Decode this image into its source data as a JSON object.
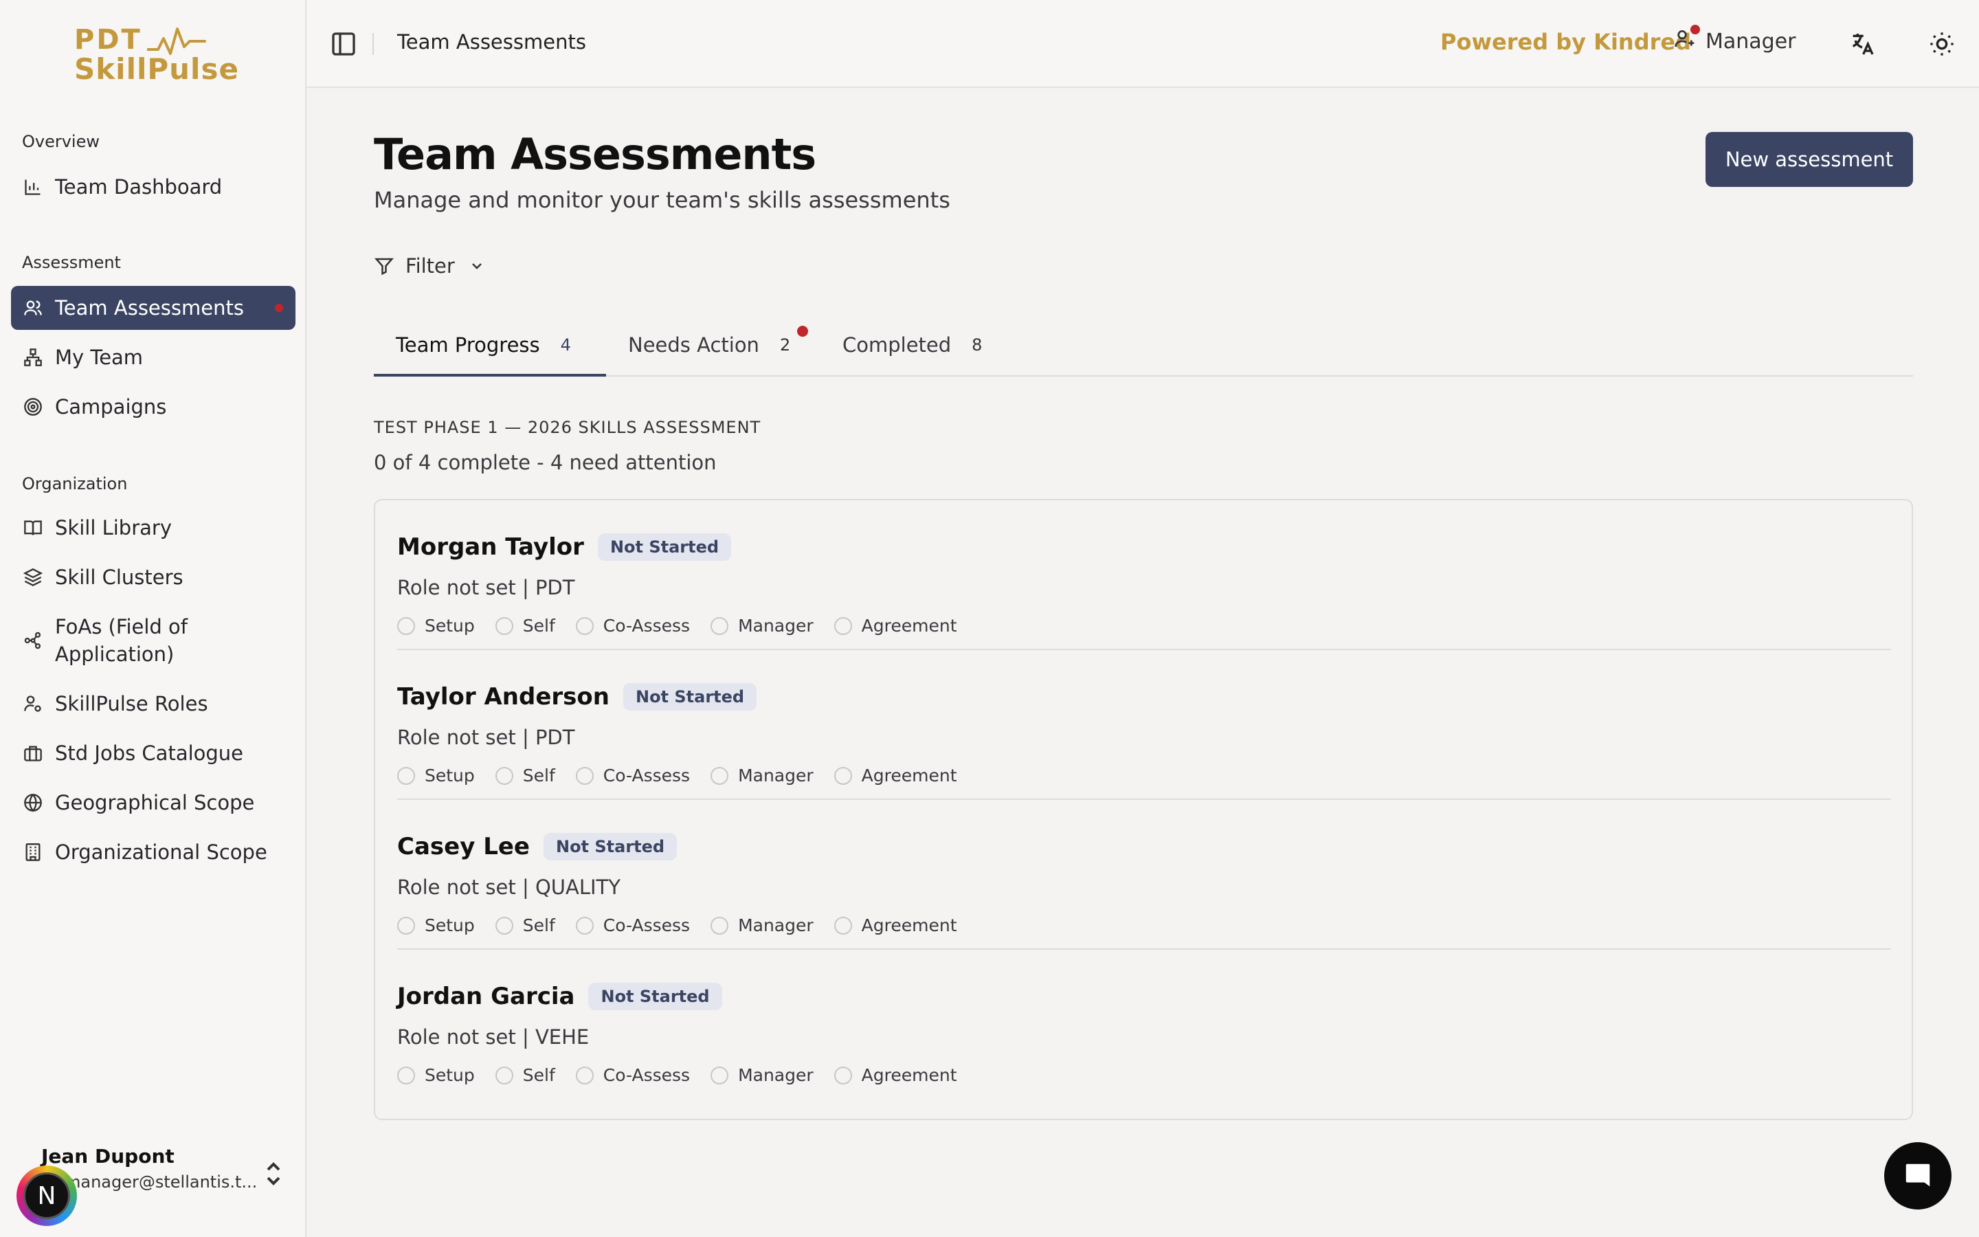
{
  "brand": {
    "line1": "PDT",
    "line2": "SkillPulse",
    "color": "#c4993e"
  },
  "sidebar": {
    "sections": [
      {
        "label": "Overview"
      },
      {
        "label": "Assessment"
      },
      {
        "label": "Organization"
      }
    ],
    "items": [
      {
        "label": "Team Dashboard",
        "icon": "bar-chart-icon"
      },
      {
        "label": "Team Assessments",
        "icon": "users-icon",
        "active": true,
        "has_notification": true
      },
      {
        "label": "My Team",
        "icon": "org-chart-icon"
      },
      {
        "label": "Campaigns",
        "icon": "target-icon"
      },
      {
        "label": "Skill Library",
        "icon": "book-icon"
      },
      {
        "label": "Skill Clusters",
        "icon": "layers-icon"
      },
      {
        "label": "FoAs (Field of Application)",
        "icon": "network-icon"
      },
      {
        "label": "SkillPulse Roles",
        "icon": "user-cog-icon"
      },
      {
        "label": "Std Jobs Catalogue",
        "icon": "briefcase-icon"
      },
      {
        "label": "Geographical Scope",
        "icon": "globe-icon"
      },
      {
        "label": "Organizational Scope",
        "icon": "building-icon"
      }
    ],
    "user": {
      "name": "Jean Dupont",
      "email": "manager@stellantis.t...",
      "avatar_initial": "N"
    }
  },
  "topbar": {
    "title": "Team Assessments",
    "powered_by": "Powered by Kindred",
    "role": "Manager"
  },
  "main": {
    "title": "Team Assessments",
    "subtitle": "Manage and monitor your team's skills assessments",
    "new_button": "New assessment",
    "filter_label": "Filter",
    "tabs": [
      {
        "label": "Team Progress",
        "count": "4",
        "active": true
      },
      {
        "label": "Needs Action",
        "count": "2",
        "has_notification": true
      },
      {
        "label": "Completed",
        "count": "8"
      }
    ],
    "campaign": {
      "label": "TEST PHASE 1 — 2026 SKILLS ASSESSMENT",
      "summary": "0 of 4 complete - 4 need attention"
    },
    "step_labels": [
      "Setup",
      "Self",
      "Co-Assess",
      "Manager",
      "Agreement"
    ],
    "members": [
      {
        "name": "Morgan Taylor",
        "status": "Not Started",
        "role": "Role not set | PDT"
      },
      {
        "name": "Taylor Anderson",
        "status": "Not Started",
        "role": "Role not set | PDT"
      },
      {
        "name": "Casey Lee",
        "status": "Not Started",
        "role": "Role not set | QUALITY"
      },
      {
        "name": "Jordan Garcia",
        "status": "Not Started",
        "role": "Role not set | VEHE"
      }
    ]
  },
  "colors": {
    "accent": "#3b4563",
    "notification": "#c0262b",
    "brand": "#c4993e"
  }
}
